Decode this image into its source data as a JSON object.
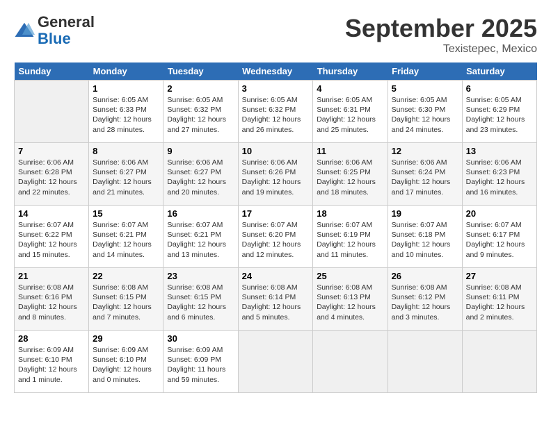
{
  "header": {
    "logo": {
      "general": "General",
      "blue": "Blue"
    },
    "month": "September 2025",
    "location": "Texistepec, Mexico"
  },
  "days_of_week": [
    "Sunday",
    "Monday",
    "Tuesday",
    "Wednesday",
    "Thursday",
    "Friday",
    "Saturday"
  ],
  "weeks": [
    [
      {
        "day": "",
        "empty": true
      },
      {
        "day": "1",
        "sunrise": "Sunrise: 6:05 AM",
        "sunset": "Sunset: 6:33 PM",
        "daylight": "Daylight: 12 hours and 28 minutes."
      },
      {
        "day": "2",
        "sunrise": "Sunrise: 6:05 AM",
        "sunset": "Sunset: 6:32 PM",
        "daylight": "Daylight: 12 hours and 27 minutes."
      },
      {
        "day": "3",
        "sunrise": "Sunrise: 6:05 AM",
        "sunset": "Sunset: 6:32 PM",
        "daylight": "Daylight: 12 hours and 26 minutes."
      },
      {
        "day": "4",
        "sunrise": "Sunrise: 6:05 AM",
        "sunset": "Sunset: 6:31 PM",
        "daylight": "Daylight: 12 hours and 25 minutes."
      },
      {
        "day": "5",
        "sunrise": "Sunrise: 6:05 AM",
        "sunset": "Sunset: 6:30 PM",
        "daylight": "Daylight: 12 hours and 24 minutes."
      },
      {
        "day": "6",
        "sunrise": "Sunrise: 6:05 AM",
        "sunset": "Sunset: 6:29 PM",
        "daylight": "Daylight: 12 hours and 23 minutes."
      }
    ],
    [
      {
        "day": "7",
        "sunrise": "Sunrise: 6:06 AM",
        "sunset": "Sunset: 6:28 PM",
        "daylight": "Daylight: 12 hours and 22 minutes."
      },
      {
        "day": "8",
        "sunrise": "Sunrise: 6:06 AM",
        "sunset": "Sunset: 6:27 PM",
        "daylight": "Daylight: 12 hours and 21 minutes."
      },
      {
        "day": "9",
        "sunrise": "Sunrise: 6:06 AM",
        "sunset": "Sunset: 6:27 PM",
        "daylight": "Daylight: 12 hours and 20 minutes."
      },
      {
        "day": "10",
        "sunrise": "Sunrise: 6:06 AM",
        "sunset": "Sunset: 6:26 PM",
        "daylight": "Daylight: 12 hours and 19 minutes."
      },
      {
        "day": "11",
        "sunrise": "Sunrise: 6:06 AM",
        "sunset": "Sunset: 6:25 PM",
        "daylight": "Daylight: 12 hours and 18 minutes."
      },
      {
        "day": "12",
        "sunrise": "Sunrise: 6:06 AM",
        "sunset": "Sunset: 6:24 PM",
        "daylight": "Daylight: 12 hours and 17 minutes."
      },
      {
        "day": "13",
        "sunrise": "Sunrise: 6:06 AM",
        "sunset": "Sunset: 6:23 PM",
        "daylight": "Daylight: 12 hours and 16 minutes."
      }
    ],
    [
      {
        "day": "14",
        "sunrise": "Sunrise: 6:07 AM",
        "sunset": "Sunset: 6:22 PM",
        "daylight": "Daylight: 12 hours and 15 minutes."
      },
      {
        "day": "15",
        "sunrise": "Sunrise: 6:07 AM",
        "sunset": "Sunset: 6:21 PM",
        "daylight": "Daylight: 12 hours and 14 minutes."
      },
      {
        "day": "16",
        "sunrise": "Sunrise: 6:07 AM",
        "sunset": "Sunset: 6:21 PM",
        "daylight": "Daylight: 12 hours and 13 minutes."
      },
      {
        "day": "17",
        "sunrise": "Sunrise: 6:07 AM",
        "sunset": "Sunset: 6:20 PM",
        "daylight": "Daylight: 12 hours and 12 minutes."
      },
      {
        "day": "18",
        "sunrise": "Sunrise: 6:07 AM",
        "sunset": "Sunset: 6:19 PM",
        "daylight": "Daylight: 12 hours and 11 minutes."
      },
      {
        "day": "19",
        "sunrise": "Sunrise: 6:07 AM",
        "sunset": "Sunset: 6:18 PM",
        "daylight": "Daylight: 12 hours and 10 minutes."
      },
      {
        "day": "20",
        "sunrise": "Sunrise: 6:07 AM",
        "sunset": "Sunset: 6:17 PM",
        "daylight": "Daylight: 12 hours and 9 minutes."
      }
    ],
    [
      {
        "day": "21",
        "sunrise": "Sunrise: 6:08 AM",
        "sunset": "Sunset: 6:16 PM",
        "daylight": "Daylight: 12 hours and 8 minutes."
      },
      {
        "day": "22",
        "sunrise": "Sunrise: 6:08 AM",
        "sunset": "Sunset: 6:15 PM",
        "daylight": "Daylight: 12 hours and 7 minutes."
      },
      {
        "day": "23",
        "sunrise": "Sunrise: 6:08 AM",
        "sunset": "Sunset: 6:15 PM",
        "daylight": "Daylight: 12 hours and 6 minutes."
      },
      {
        "day": "24",
        "sunrise": "Sunrise: 6:08 AM",
        "sunset": "Sunset: 6:14 PM",
        "daylight": "Daylight: 12 hours and 5 minutes."
      },
      {
        "day": "25",
        "sunrise": "Sunrise: 6:08 AM",
        "sunset": "Sunset: 6:13 PM",
        "daylight": "Daylight: 12 hours and 4 minutes."
      },
      {
        "day": "26",
        "sunrise": "Sunrise: 6:08 AM",
        "sunset": "Sunset: 6:12 PM",
        "daylight": "Daylight: 12 hours and 3 minutes."
      },
      {
        "day": "27",
        "sunrise": "Sunrise: 6:08 AM",
        "sunset": "Sunset: 6:11 PM",
        "daylight": "Daylight: 12 hours and 2 minutes."
      }
    ],
    [
      {
        "day": "28",
        "sunrise": "Sunrise: 6:09 AM",
        "sunset": "Sunset: 6:10 PM",
        "daylight": "Daylight: 12 hours and 1 minute."
      },
      {
        "day": "29",
        "sunrise": "Sunrise: 6:09 AM",
        "sunset": "Sunset: 6:10 PM",
        "daylight": "Daylight: 12 hours and 0 minutes."
      },
      {
        "day": "30",
        "sunrise": "Sunrise: 6:09 AM",
        "sunset": "Sunset: 6:09 PM",
        "daylight": "Daylight: 11 hours and 59 minutes."
      },
      {
        "day": "",
        "empty": true
      },
      {
        "day": "",
        "empty": true
      },
      {
        "day": "",
        "empty": true
      },
      {
        "day": "",
        "empty": true
      }
    ]
  ]
}
